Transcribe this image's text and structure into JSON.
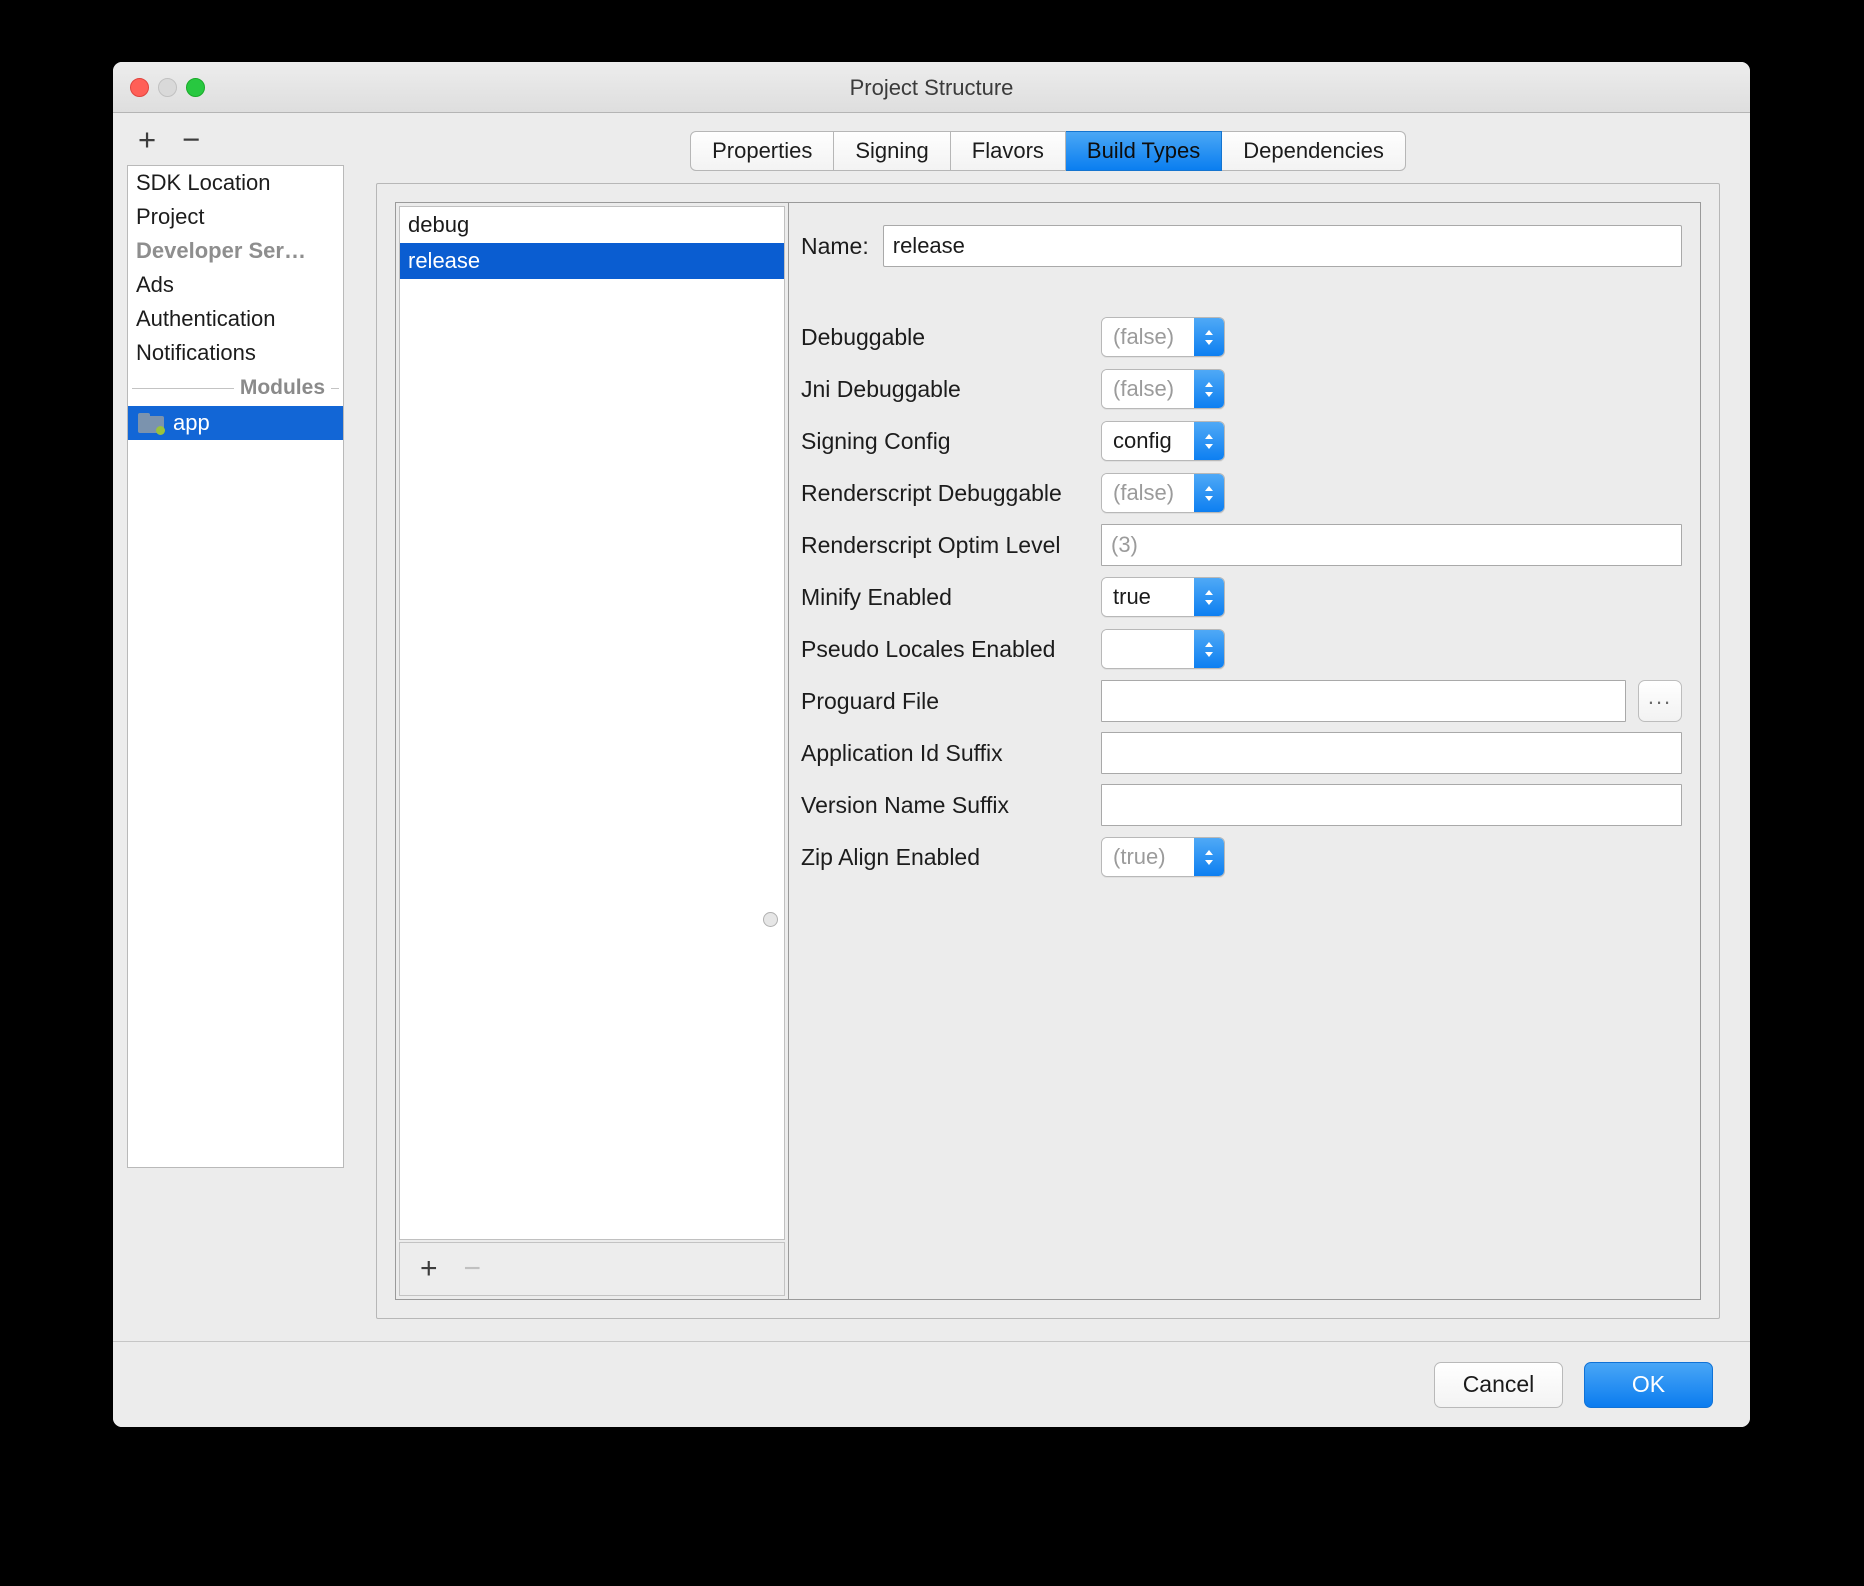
{
  "window": {
    "title": "Project Structure",
    "traffic_lights": [
      "close",
      "minimize",
      "zoom"
    ]
  },
  "sidebar": {
    "toolbar": {
      "add_label": "+",
      "remove_label": "−"
    },
    "items": [
      {
        "label": "SDK Location",
        "state": "normal"
      },
      {
        "label": "Project",
        "state": "normal"
      },
      {
        "label": "Developer Ser…",
        "state": "muted"
      },
      {
        "label": "Ads",
        "state": "normal"
      },
      {
        "label": "Authentication",
        "state": "normal"
      },
      {
        "label": "Notifications",
        "state": "normal"
      }
    ],
    "section_label": "Modules",
    "module": {
      "label": "app",
      "selected": true,
      "icon": "folder-icon"
    }
  },
  "tabs": [
    {
      "label": "Properties",
      "active": false
    },
    {
      "label": "Signing",
      "active": false
    },
    {
      "label": "Flavors",
      "active": false
    },
    {
      "label": "Build Types",
      "active": true
    },
    {
      "label": "Dependencies",
      "active": false
    }
  ],
  "build_types": {
    "items": [
      {
        "label": "debug",
        "selected": false
      },
      {
        "label": "release",
        "selected": true
      }
    ],
    "toolbar": {
      "add_label": "+",
      "remove_label": "−"
    }
  },
  "form": {
    "name_label": "Name:",
    "name_value": "release",
    "rows": [
      {
        "label": "Debuggable",
        "value": "(false)",
        "kind": "combo",
        "placeholder": true
      },
      {
        "label": "Jni Debuggable",
        "value": "(false)",
        "kind": "combo",
        "placeholder": true
      },
      {
        "label": "Signing Config",
        "value": "config",
        "kind": "combo",
        "placeholder": false
      },
      {
        "label": "Renderscript Debuggable",
        "value": "(false)",
        "kind": "combo",
        "placeholder": true
      },
      {
        "label": "Renderscript Optim Level",
        "value": "(3)",
        "kind": "text",
        "placeholder": true
      },
      {
        "label": "Minify Enabled",
        "value": "true",
        "kind": "combo",
        "placeholder": false
      },
      {
        "label": "Pseudo Locales Enabled",
        "value": "",
        "kind": "combo",
        "placeholder": false
      },
      {
        "label": "Proguard File",
        "value": "",
        "kind": "text-browse",
        "placeholder": false,
        "browse_label": "..."
      },
      {
        "label": "Application Id Suffix",
        "value": "",
        "kind": "text",
        "placeholder": false
      },
      {
        "label": "Version Name Suffix",
        "value": "",
        "kind": "text",
        "placeholder": false
      },
      {
        "label": "Zip Align Enabled",
        "value": "(true)",
        "kind": "combo",
        "placeholder": true
      }
    ]
  },
  "footer": {
    "cancel_label": "Cancel",
    "ok_label": "OK"
  },
  "colors": {
    "accent_blue": "#0a7ef0",
    "selection_blue": "#0a5dd1",
    "module_selection": "#1266d6",
    "window_bg": "#ececec"
  }
}
